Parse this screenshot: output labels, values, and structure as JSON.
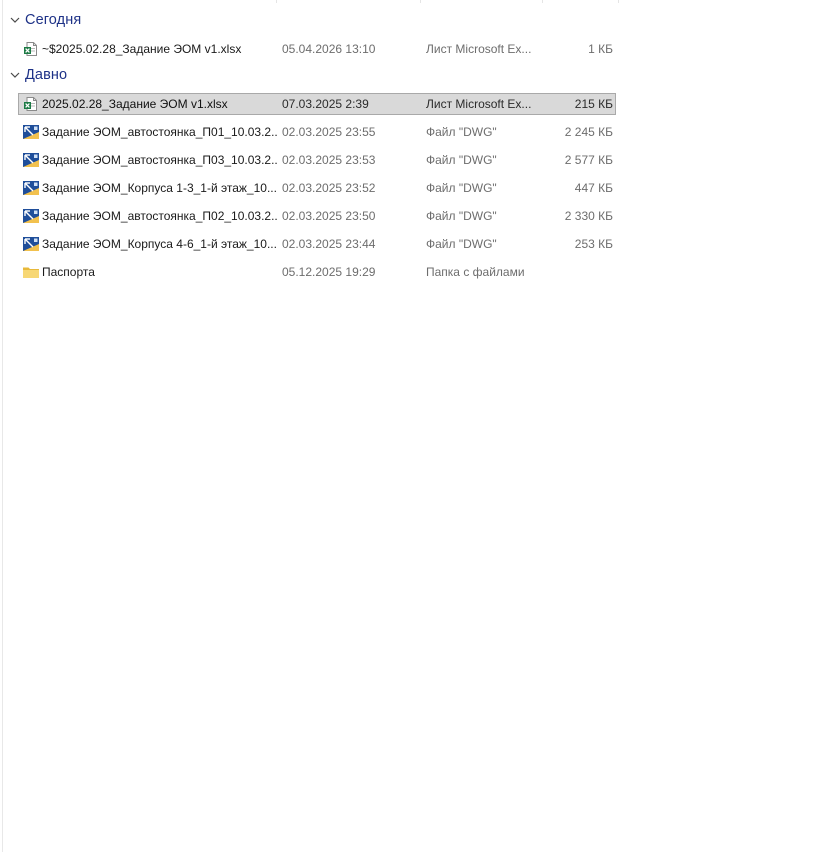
{
  "groups": [
    {
      "title": "Сегодня",
      "items": [
        {
          "icon": "excel-file-icon",
          "name": "~$2025.02.28_Задание ЭОМ v1.xlsx",
          "date": "05.04.2026 13:10",
          "type": "Лист Microsoft Ex...",
          "size": "1 КБ",
          "selected": false
        }
      ]
    },
    {
      "title": "Давно",
      "items": [
        {
          "icon": "excel-file-icon",
          "name": "2025.02.28_Задание ЭОМ v1.xlsx",
          "date": "07.03.2025 2:39",
          "type": "Лист Microsoft Ex...",
          "size": "215 КБ",
          "selected": true
        },
        {
          "icon": "dwg-file-icon",
          "name": "Задание ЭОМ_автостоянка_П01_10.03.2...",
          "date": "02.03.2025 23:55",
          "type": "Файл \"DWG\"",
          "size": "2 245 КБ",
          "selected": false
        },
        {
          "icon": "dwg-file-icon",
          "name": "Задание ЭОМ_автостоянка_П03_10.03.2...",
          "date": "02.03.2025 23:53",
          "type": "Файл \"DWG\"",
          "size": "2 577 КБ",
          "selected": false
        },
        {
          "icon": "dwg-file-icon",
          "name": "Задание ЭОМ_Корпуса 1-3_1-й этаж_10...",
          "date": "02.03.2025 23:52",
          "type": "Файл \"DWG\"",
          "size": "447 КБ",
          "selected": false
        },
        {
          "icon": "dwg-file-icon",
          "name": "Задание ЭОМ_автостоянка_П02_10.03.2...",
          "date": "02.03.2025 23:50",
          "type": "Файл \"DWG\"",
          "size": "2 330 КБ",
          "selected": false
        },
        {
          "icon": "dwg-file-icon",
          "name": "Задание ЭОМ_Корпуса 4-6_1-й этаж_10...",
          "date": "02.03.2025 23:44",
          "type": "Файл \"DWG\"",
          "size": "253 КБ",
          "selected": false
        },
        {
          "icon": "folder-icon",
          "name": "Паспорта",
          "date": "05.12.2025 19:29",
          "type": "Папка с файлами",
          "size": "",
          "selected": false
        }
      ]
    }
  ],
  "colors": {
    "group_title": "#1e3287",
    "selection_bg": "#d9d9d9",
    "selection_border": "#a9a9a9",
    "secondary_text": "#6d6d6d",
    "excel_green": "#1d7a45",
    "dwg_blue": "#1f4e9a",
    "dwg_yellow": "#f2c14e",
    "folder_yellow": "#f7d774"
  }
}
